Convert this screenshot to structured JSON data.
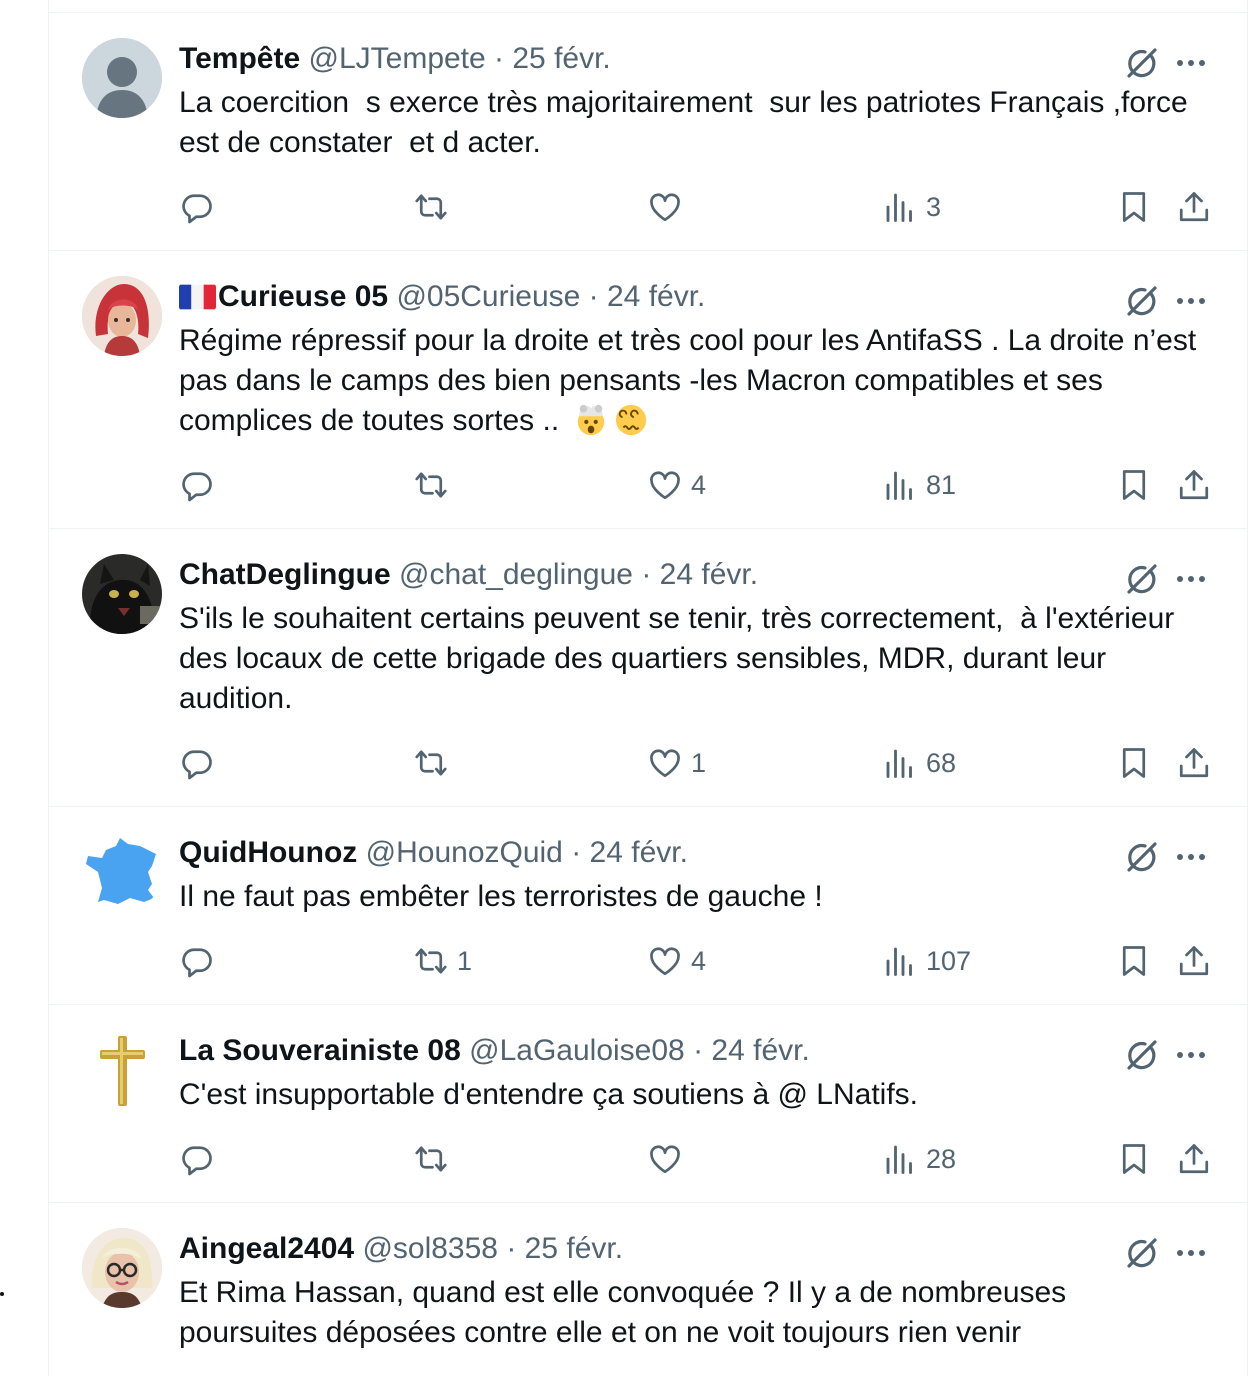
{
  "tweets": [
    {
      "name": "Tempête",
      "handle": "@LJTempete",
      "date": "· 25 févr.",
      "text": "La coercition  s exerce très majoritairement  sur les patriotes Français ,force est de constater  et d acter.",
      "replies": "",
      "retweets": "",
      "likes": "",
      "views": "3",
      "avatar": "default-avatar-icon"
    },
    {
      "name": "Curieuse 05",
      "flag": "france-flag-icon",
      "handle": "@05Curieuse",
      "date": "· 24 févr.",
      "text": "Régime répressif pour la droite et très cool pour les AntifaSS . La droite n’est pas dans le camps des bien pensants -les Macron compatibles et ses complices de toutes sortes .. ",
      "emojis": [
        "exploding-head-emoji",
        "dizzy-face-emoji"
      ],
      "replies": "",
      "retweets": "",
      "likes": "4",
      "views": "81",
      "avatar": "red-haired-woman-avatar"
    },
    {
      "name": "ChatDeglingue",
      "handle": "@chat_deglingue",
      "date": "· 24 févr.",
      "text": "S'ils le souhaitent certains peuvent se tenir, très correctement,  à l'extérieur des locaux de cette brigade des quartiers sensibles, MDR, durant leur audition.",
      "replies": "",
      "retweets": "",
      "likes": "1",
      "views": "68",
      "avatar": "black-cat-avatar"
    },
    {
      "name": "QuidHounoz",
      "handle": "@HounozQuid",
      "date": "· 24 févr.",
      "text": "Il ne faut pas embêter les terroristes de gauche !",
      "replies": "",
      "retweets": "1",
      "likes": "4",
      "views": "107",
      "avatar": "france-map-avatar"
    },
    {
      "name": "La Souverainiste 08",
      "handle": "@LaGauloise08",
      "date": "· 24 févr.",
      "text": "C'est insupportable d'entendre ça soutiens à @ LNatifs.",
      "replies": "",
      "retweets": "",
      "likes": "",
      "views": "28",
      "avatar": "golden-cross-avatar"
    },
    {
      "name": "Aingeal2404",
      "handle": "@sol8358",
      "date": "· 25 févr.",
      "text": "Et Rima Hassan, quand est elle convoquée ? Il y a de nombreuses poursuites déposées contre elle et on ne voit toujours rien venir",
      "replies": "",
      "retweets": "",
      "likes": "",
      "views": "",
      "avatar": "blonde-woman-glasses-avatar"
    }
  ],
  "colors": {
    "text": "#0f1419",
    "secondary": "#536471",
    "divider": "#eff3f4",
    "background": "#ffffff"
  }
}
